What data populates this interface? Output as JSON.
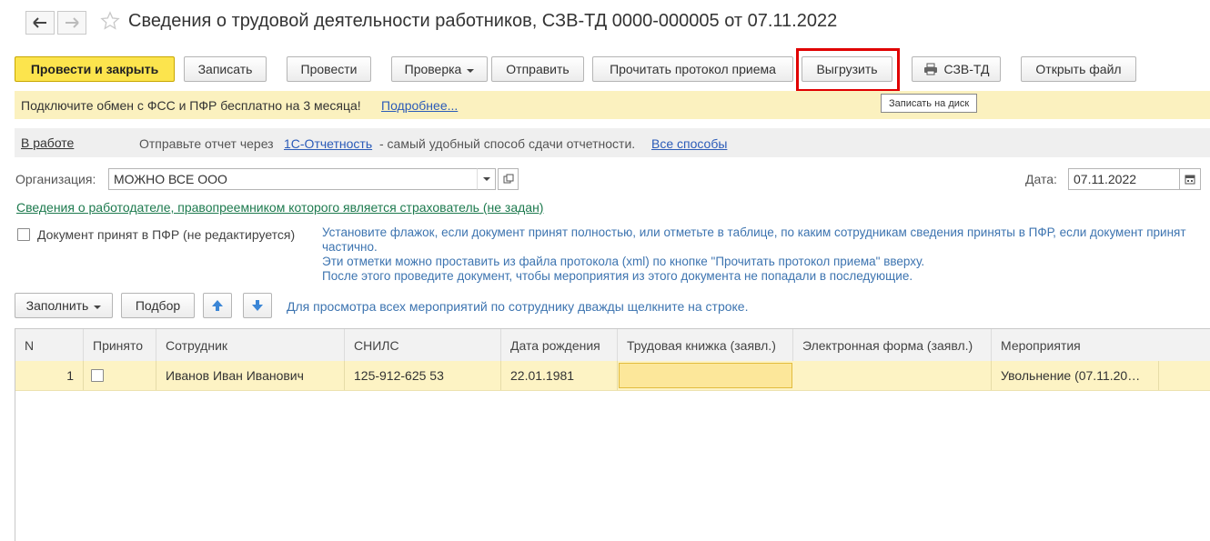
{
  "header": {
    "title": "Сведения о трудовой деятельности работников, СЗВ-ТД 0000-000005 от 07.11.2022",
    "back_icon": "arrow-left-icon",
    "forward_icon": "arrow-right-icon",
    "favorite_icon": "star-icon"
  },
  "toolbar": {
    "post_close": "Провести и закрыть",
    "save": "Записать",
    "post": "Провести",
    "check": "Проверка",
    "send": "Отправить",
    "read_protocol": "Прочитать протокол приема",
    "export": "Выгрузить",
    "print_szv": "СЗВ-ТД",
    "open_file": "Открыть файл",
    "export_tooltip": "Записать на диск",
    "highlight_color": "#e00000"
  },
  "notice": {
    "text": "Подключите обмен с ФСС и ПФР бесплатно на 3 месяца!",
    "link": "Подробнее..."
  },
  "status": {
    "state": "В работе",
    "text_before": "Отправьте отчет через",
    "service_link": "1С-Отчетность",
    "text_after": "- самый удобный способ сдачи отчетности.",
    "all_ways_link": "Все способы"
  },
  "form": {
    "org_label": "Организация:",
    "org_value": "МОЖНО ВСЕ ООО",
    "date_label": "Дата:",
    "date_value": "07.11.2022",
    "employer_link": "Сведения о работодателе, правопреемником которого является страхователь (не задан)",
    "accepted_label": "Документ принят в ПФР (не редактируется)",
    "hint_lines": [
      "Установите флажок, если документ принят полностью, или отметьте в таблице, по каким сотрудникам сведения приняты в ПФР, если документ принят",
      "частично.",
      "Эти отметки можно проставить из файла протокола (xml) по кнопке \"Прочитать протокол приема\" вверху.",
      "После этого проведите документ, чтобы мероприятия из этого документа не попадали в последующие."
    ]
  },
  "table_toolbar": {
    "fill": "Заполнить",
    "select": "Подбор",
    "hint": "Для просмотра всех мероприятий по сотруднику дважды щелкните на строке."
  },
  "table": {
    "columns": [
      "N",
      "Принято",
      "Сотрудник",
      "СНИЛС",
      "Дата рождения",
      "Трудовая книжка (заявл.)",
      "Электронная форма (заявл.)",
      "Мероприятия"
    ],
    "rows": [
      {
        "n": "1",
        "accepted": false,
        "employee": "Иванов Иван Иванович",
        "snils": "125-912-625 53",
        "birth_date": "22.01.1981",
        "paper_book": "",
        "electronic_form": "",
        "events": "Увольнение (07.11.20…"
      }
    ],
    "row_highlight_color": "#fdf3c4",
    "active_cell_color": "#fce79a"
  }
}
